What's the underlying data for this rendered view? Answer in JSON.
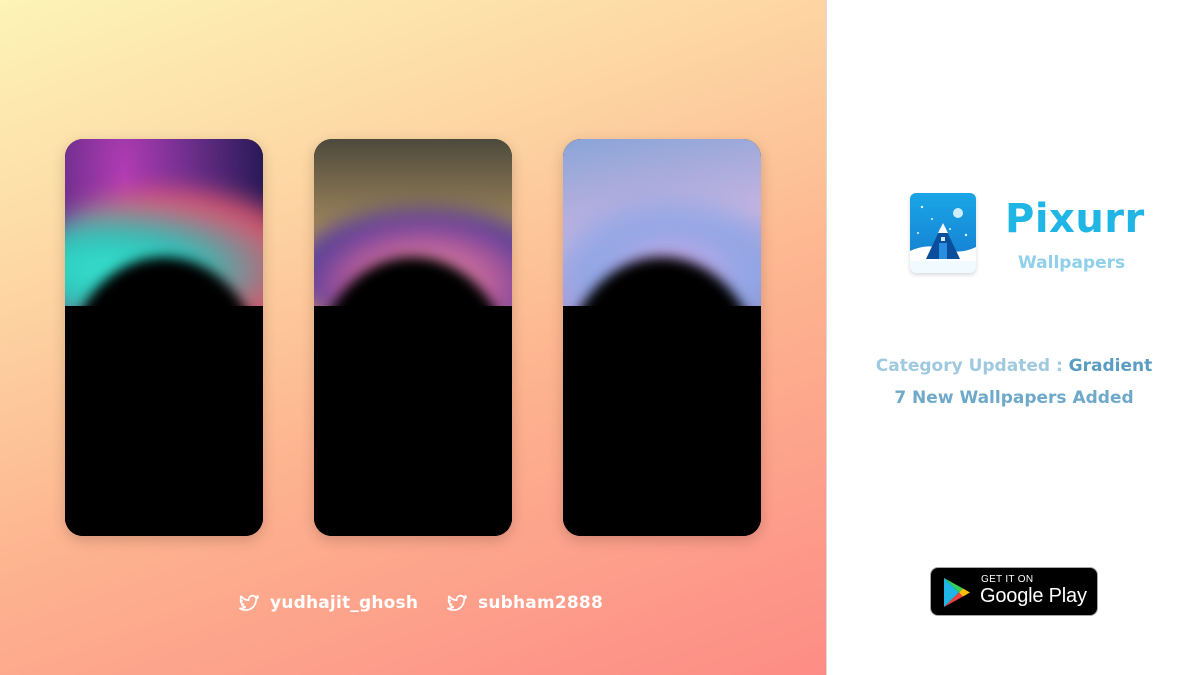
{
  "showcase": {
    "phones": [
      {
        "alt_name": "gradient-wallpaper-1"
      },
      {
        "alt_name": "gradient-wallpaper-2"
      },
      {
        "alt_name": "gradient-wallpaper-3"
      }
    ],
    "twitter_handles": [
      "yudhajit_ghosh",
      "subham2888"
    ],
    "icons": {
      "twitter": "twitter-bird-icon"
    }
  },
  "app": {
    "name": "Pixurr",
    "subtitle": "Wallpapers",
    "icon": "pixurr-app-icon",
    "brand_color": "#1fb6e6"
  },
  "update": {
    "category_label": "Category Updated : ",
    "category_value": "Gradient",
    "count_text": "7 New Wallpapers Added"
  },
  "store_badge": {
    "small_text": "GET IT ON",
    "big_text": "Google Play",
    "icon": "google-play-icon"
  }
}
